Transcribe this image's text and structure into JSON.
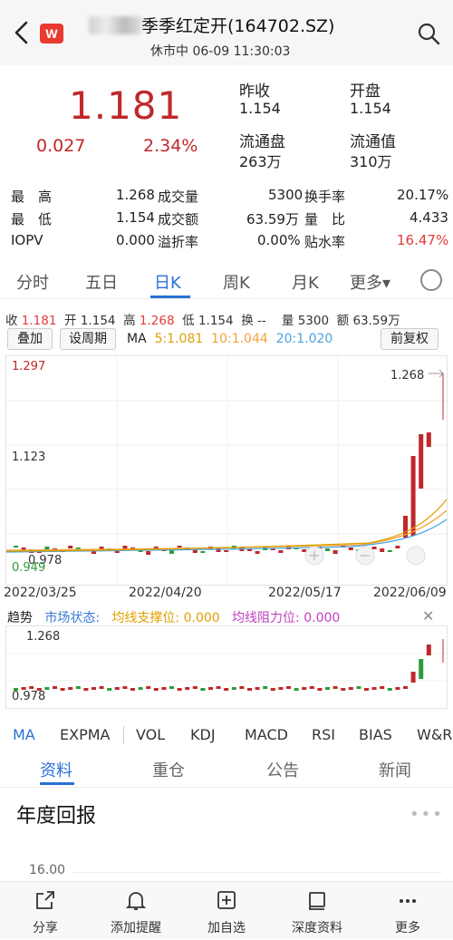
{
  "header": {
    "title": "季季红定开(164702.SZ)",
    "subtitle": "休市中 06-09 11:30:03",
    "logo": "W"
  },
  "quote": {
    "price": "1.181",
    "change": "0.027",
    "change_pct": "2.34%",
    "fields": [
      {
        "label": "昨收",
        "value": "1.154"
      },
      {
        "label": "开盘",
        "value": "1.154"
      },
      {
        "label": "流通盘",
        "value": "263万"
      },
      {
        "label": "流通值",
        "value": "310万"
      }
    ]
  },
  "stats": {
    "rows": [
      {
        "l1": "最　高",
        "v1": "1.268",
        "l2": "成交量",
        "v2": "5300",
        "l3": "换手率",
        "v3": "20.17%"
      },
      {
        "l1": "最　低",
        "v1": "1.154",
        "l2": "成交额",
        "v2": "63.59万",
        "l3": "量　比",
        "v3": "4.433"
      },
      {
        "l1": "IOPV",
        "v1": "0.000",
        "l2": "溢折率",
        "v2": "0.00%",
        "l3": "贴水率",
        "v3": "16.47%"
      }
    ]
  },
  "tabs": [
    "分时",
    "五日",
    "日K",
    "周K",
    "月K",
    "更多▾"
  ],
  "tabs_active": 2,
  "ohlc": {
    "close_label": "收",
    "close": "1.181",
    "open_label": "开",
    "open": "1.154",
    "high_label": "高",
    "high": "1.268",
    "low_label": "低",
    "low": "1.154",
    "turn_label": "换",
    "turn": "--",
    "vol_label": "量",
    "vol": "5300",
    "amt_label": "额",
    "amt": "63.59万"
  },
  "toolbar": {
    "overlay": "叠加",
    "period": "设周期",
    "restore": "前复权"
  },
  "ma": {
    "label": "MA",
    "ma5": "5:1.081",
    "ma10": "10:1.044",
    "ma20": "20:1.020",
    "colors": {
      "ma5": "#e0a000",
      "ma10": "#f0a43a",
      "ma20": "#4aa3df"
    }
  },
  "kchart": {
    "y_top": "1.297",
    "y_mid": "1.123",
    "y_low": "0.978",
    "y_min": "0.949",
    "max_marker": "1.268",
    "dates": [
      "2022/03/25",
      "2022/04/20",
      "2022/05/17",
      "2022/06/09"
    ]
  },
  "trend": {
    "label": "趋势",
    "market": "市场状态:",
    "support": "均线支撑位: 0.000",
    "resist": "均线阻力位: 0.000",
    "colors": {
      "market": "#3a7bd5",
      "support": "#e0a000",
      "resist": "#c040c0"
    }
  },
  "vchart": {
    "top": "1.268",
    "low": "0.978"
  },
  "indicators": [
    "MA",
    "EXPMA",
    "VOL",
    "KDJ",
    "MACD",
    "RSI",
    "BIAS",
    "W&R"
  ],
  "sections": [
    "资料",
    "重仓",
    "公告",
    "新闻"
  ],
  "annual": {
    "title": "年度回报",
    "ytick": "16.00"
  },
  "bottom": [
    {
      "label": "分享",
      "icon": "share-icon"
    },
    {
      "label": "添加提醒",
      "icon": "bell-icon"
    },
    {
      "label": "加自选",
      "icon": "add-icon"
    },
    {
      "label": "深度资料",
      "icon": "book-icon"
    },
    {
      "label": "更多",
      "icon": "more-icon"
    }
  ],
  "chart_data": {
    "type": "candlestick",
    "title": "",
    "dates": [
      "2022/03/25",
      "2022/04/20",
      "2022/05/17",
      "2022/06/09"
    ],
    "ylim": [
      0.949,
      1.297
    ],
    "last_close": 1.181,
    "period_high": 1.268,
    "ma": {
      "ma5": 1.081,
      "ma10": 1.044,
      "ma20": 1.02
    }
  }
}
